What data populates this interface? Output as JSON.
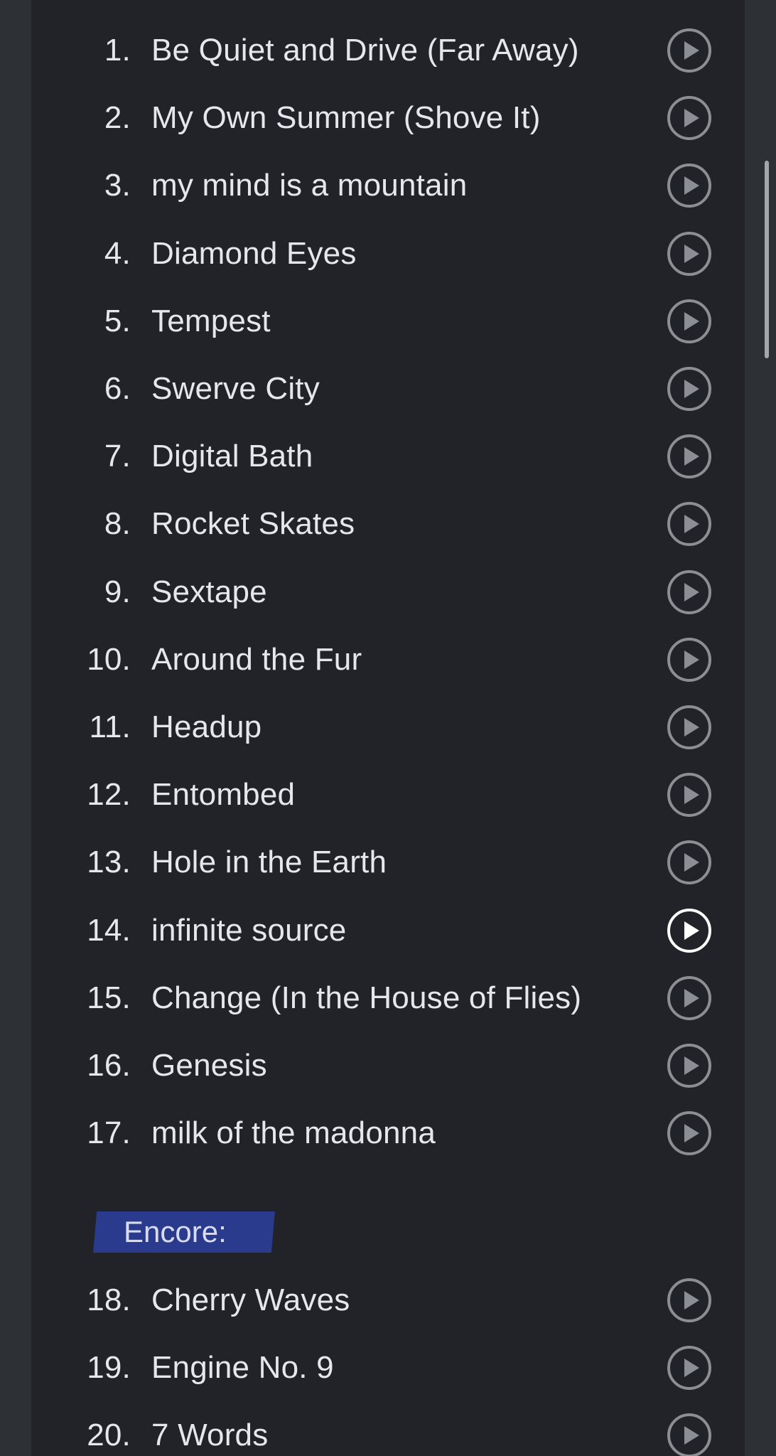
{
  "setlist": {
    "main": [
      {
        "number": "1.",
        "title": "Be Quiet and Drive (Far Away)",
        "active": false
      },
      {
        "number": "2.",
        "title": "My Own Summer (Shove It)",
        "active": false
      },
      {
        "number": "3.",
        "title": "my mind is a mountain",
        "active": false
      },
      {
        "number": "4.",
        "title": "Diamond Eyes",
        "active": false
      },
      {
        "number": "5.",
        "title": "Tempest",
        "active": false
      },
      {
        "number": "6.",
        "title": "Swerve City",
        "active": false
      },
      {
        "number": "7.",
        "title": "Digital Bath",
        "active": false
      },
      {
        "number": "8.",
        "title": "Rocket Skates",
        "active": false
      },
      {
        "number": "9.",
        "title": "Sextape",
        "active": false
      },
      {
        "number": "10.",
        "title": "Around the Fur",
        "active": false
      },
      {
        "number": "11.",
        "title": "Headup",
        "active": false
      },
      {
        "number": "12.",
        "title": "Entombed",
        "active": false
      },
      {
        "number": "13.",
        "title": "Hole in the Earth",
        "active": false
      },
      {
        "number": "14.",
        "title": "infinite source",
        "active": true
      },
      {
        "number": "15.",
        "title": "Change (In the House of Flies)",
        "active": false
      },
      {
        "number": "16.",
        "title": "Genesis",
        "active": false
      },
      {
        "number": "17.",
        "title": "milk of the madonna",
        "active": false
      }
    ],
    "encore_label": "Encore:",
    "encore": [
      {
        "number": "18.",
        "title": "Cherry Waves",
        "active": false
      },
      {
        "number": "19.",
        "title": "Engine No. 9",
        "active": false
      },
      {
        "number": "20.",
        "title": "7 Words",
        "active": false
      }
    ]
  },
  "icons": {
    "play": "play-icon"
  },
  "colors": {
    "page_background": "#2d3035",
    "panel_background": "#212328",
    "text": "#e6e7ea",
    "icon_inactive": "#8b8e94",
    "icon_active": "#ffffff",
    "encore_highlight": "#2a3a8c"
  }
}
